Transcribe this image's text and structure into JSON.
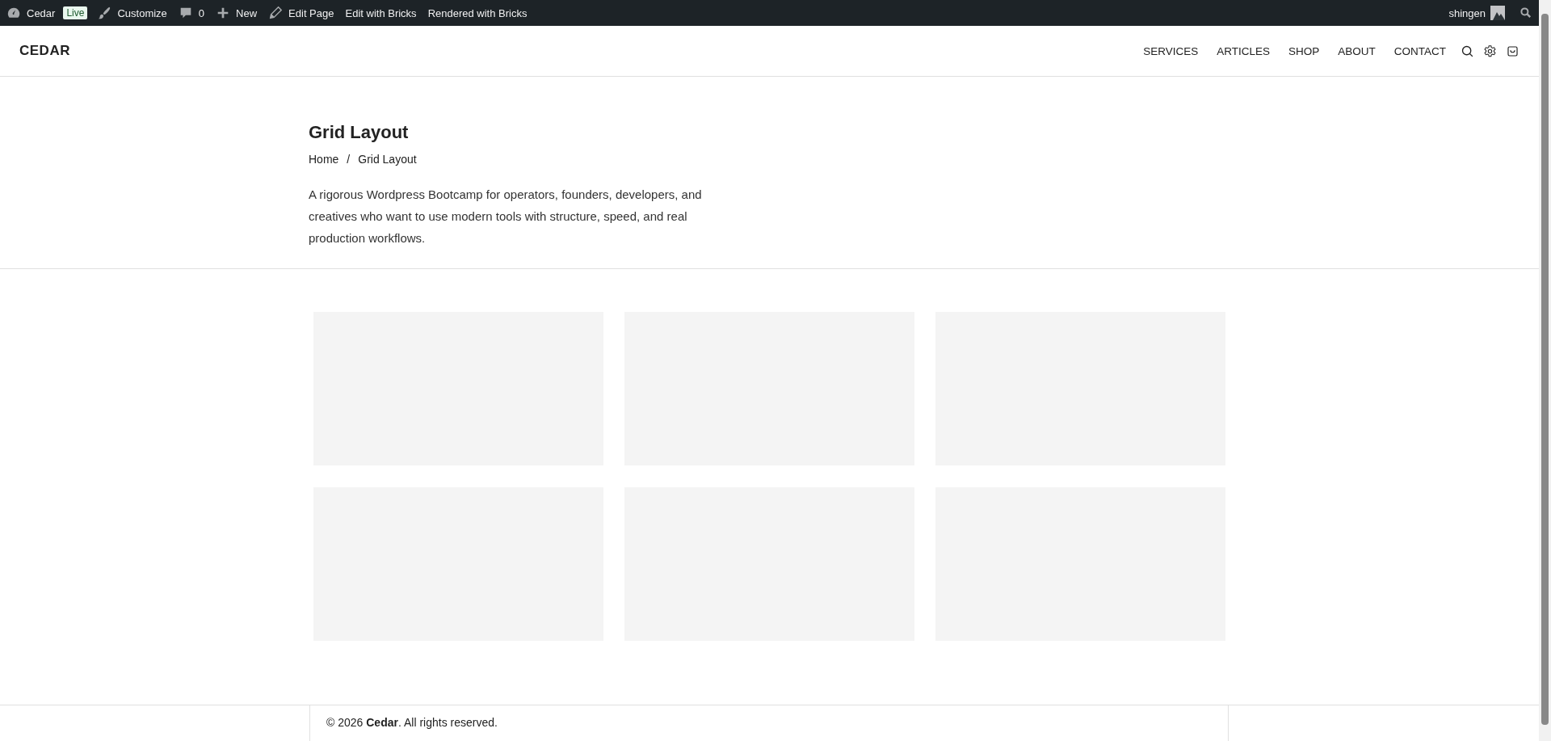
{
  "admin_bar": {
    "items": [
      {
        "kind": "site",
        "label": "Cedar"
      },
      {
        "kind": "badge",
        "label": "Live"
      },
      {
        "kind": "customize",
        "label": "Customize"
      },
      {
        "kind": "comments",
        "label": "0"
      },
      {
        "kind": "new",
        "label": "New"
      },
      {
        "kind": "edit",
        "label": "Edit Page"
      },
      {
        "kind": "text",
        "label": "Edit with Bricks"
      },
      {
        "kind": "text",
        "label": "Rendered with Bricks"
      }
    ],
    "user": "shingen"
  },
  "header": {
    "logo": "CEDAR",
    "nav": [
      "SERVICES",
      "ARTICLES",
      "SHOP",
      "ABOUT",
      "CONTACT"
    ]
  },
  "hero": {
    "title": "Grid Layout",
    "breadcrumb": [
      "Home",
      "Grid Layout"
    ],
    "separator": "/",
    "description": "A rigorous Wordpress Bootcamp for operators, founders, developers, and creatives who want to use modern tools with structure, speed, and real production workflows."
  },
  "grid": {
    "cells": [
      {
        "kind": "placeholder"
      },
      {
        "kind": "placeholder"
      },
      {
        "kind": "placeholder"
      },
      {
        "kind": "placeholder"
      },
      {
        "kind": "placeholder"
      },
      {
        "kind": "placeholder"
      }
    ]
  },
  "footer": {
    "copyright": "© 2026 **Cedar**. All rights reserved."
  }
}
